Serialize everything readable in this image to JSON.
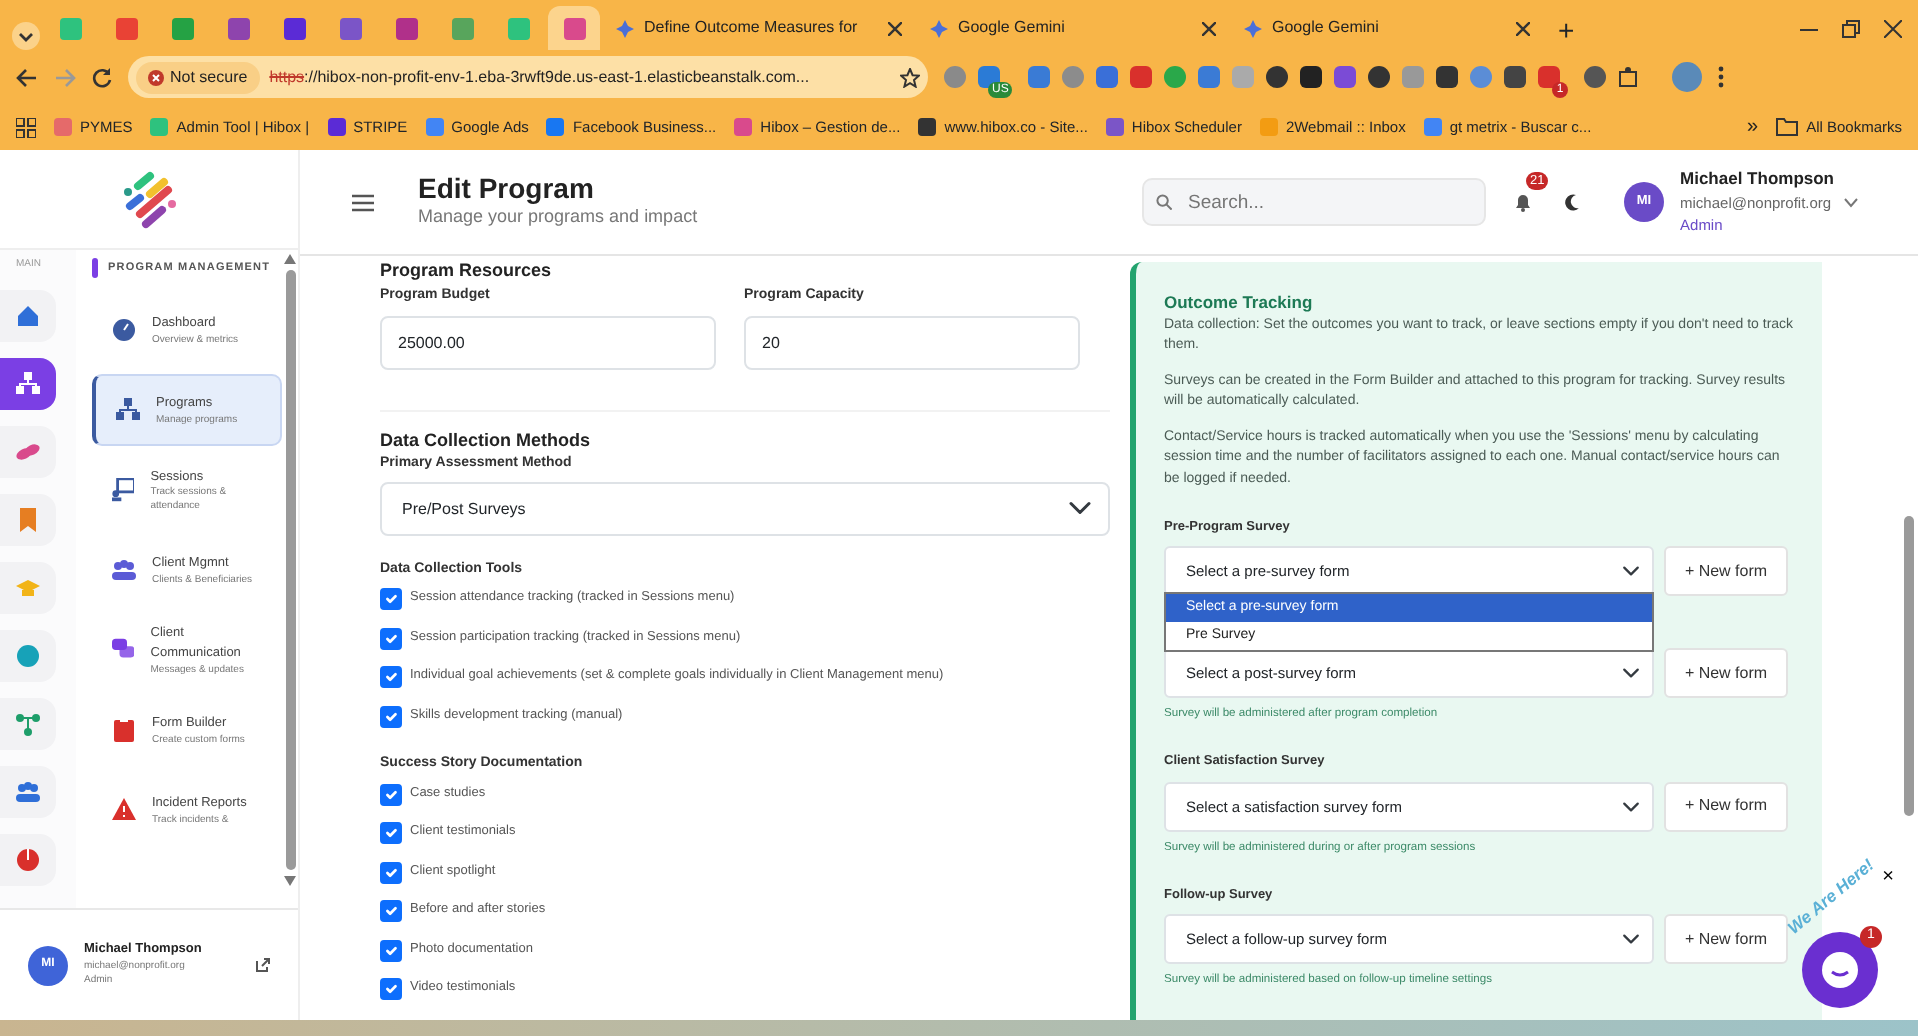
{
  "browser": {
    "tabs": [
      {
        "selected": false
      },
      {
        "selected": false
      },
      {
        "selected": false
      },
      {
        "selected": false
      },
      {
        "selected": false
      },
      {
        "selected": false
      },
      {
        "selected": false
      },
      {
        "selected": false
      },
      {
        "selected": false
      },
      {
        "selected": true
      },
      {
        "title": "Define Outcome Measures for",
        "selected": false
      },
      {
        "title": "Google Gemini",
        "selected": false
      },
      {
        "title": "Google Gemini",
        "selected": false
      }
    ],
    "new_tab": "+",
    "address": {
      "security": "Not secure",
      "scheme": "https",
      "rest": "://hibox-non-profit-env-1.eba-3rwft9de.us-east-1.elasticbeanstalk.com..."
    },
    "extension_badges": {
      "us": "US",
      "count": "1"
    },
    "bookmarks": [
      "PYMES",
      "Admin Tool | Hibox |",
      "STRIPE",
      "Google Ads",
      "Facebook Business...",
      "Hibox – Gestion de...",
      "www.hibox.co - Site...",
      "Hibox Scheduler",
      "2Webmail :: Inbox",
      "gt metrix - Buscar c..."
    ],
    "more_bookmarks": "»",
    "all_bookmarks": "All Bookmarks"
  },
  "header": {
    "title": "Edit Program",
    "subtitle": "Manage your programs and impact",
    "search": {
      "placeholder": "Search..."
    },
    "notifications": "21",
    "user": {
      "initials": "MI",
      "name": "Michael Thompson",
      "email": "michael@nonprofit.org",
      "role": "Admin"
    }
  },
  "sidebar": {
    "rail_label": "MAIN",
    "rail": [
      {
        "selected": false
      },
      {
        "selected": true
      },
      {
        "selected": false
      },
      {
        "selected": false
      },
      {
        "selected": false
      },
      {
        "selected": false
      },
      {
        "selected": false
      },
      {
        "selected": false
      },
      {
        "selected": false
      }
    ],
    "section": "PROGRAM MANAGEMENT",
    "items": [
      {
        "title": "Dashboard",
        "subtitle": "Overview & metrics",
        "selected": false
      },
      {
        "title": "Programs",
        "subtitle": "Manage programs",
        "selected": true
      },
      {
        "title": "Sessions",
        "subtitle": "Track sessions & attendance",
        "selected": false
      },
      {
        "title": "Client Mgmnt",
        "subtitle": "Clients & Beneficiaries",
        "selected": false
      },
      {
        "title": "Client Communication",
        "subtitle": "Messages & updates",
        "selected": false
      },
      {
        "title": "Form Builder",
        "subtitle": "Create custom forms",
        "selected": false
      },
      {
        "title": "Incident Reports",
        "subtitle": "Track incidents &",
        "selected": false
      }
    ],
    "user": {
      "initials": "MI",
      "name": "Michael Thompson",
      "email": "michael@nonprofit.org",
      "role": "Admin"
    }
  },
  "resources": {
    "title": "Program Resources",
    "fields": [
      {
        "label": "Program Budget",
        "value": "25000.00"
      },
      {
        "label": "Program Capacity",
        "value": "20"
      }
    ]
  },
  "methods": {
    "title": "Data Collection Methods",
    "select_label": "Primary Assessment Method",
    "select_value": "Pre/Post Surveys",
    "groups": [
      {
        "title": "Data Collection Tools",
        "options": [
          {
            "label": "Session attendance tracking (tracked in Sessions menu)",
            "checked": true
          },
          {
            "label": "Session participation tracking (tracked in Sessions menu)",
            "checked": true
          },
          {
            "label": "Individual goal achievements (set & complete goals individually in Client Management menu)",
            "checked": true
          },
          {
            "label": "Skills development tracking (manual)",
            "checked": true
          }
        ]
      },
      {
        "title": "Success Story Documentation",
        "options": [
          {
            "label": "Case studies",
            "checked": true
          },
          {
            "label": "Client testimonials",
            "checked": true
          },
          {
            "label": "Client spotlight",
            "checked": true
          },
          {
            "label": "Before and after stories",
            "checked": true
          },
          {
            "label": "Photo documentation",
            "checked": true
          },
          {
            "label": "Video testimonials",
            "checked": true
          }
        ]
      }
    ]
  },
  "outcome": {
    "title": "Outcome Tracking",
    "paragraphs": [
      {
        "text": "Data collection: Set the outcomes you want to track, or leave sections empty if you don't need to track them."
      },
      {
        "text": "Surveys can be created in the",
        "link": "Form Builder",
        "after": "and attached to this program for tracking. Survey results will be automatically calculated."
      },
      {
        "text": "Contact/Service hours is tracked automatically when you use the 'Sessions' menu by calculating session time and the number of facilitators assigned to each one. Manual contact/service hours can be logged if needed."
      }
    ],
    "surveys": [
      {
        "label": "Pre-Program Survey",
        "value": "Select a pre-survey form",
        "button": "+ New form",
        "open_options": [
          {
            "label": "Select a pre-survey form",
            "selected": true
          },
          {
            "label": "Pre Survey",
            "selected": false
          }
        ]
      },
      {
        "value": "Select a post-survey form",
        "button": "+ New form",
        "help": "Survey will be administered after program completion"
      },
      {
        "label": "Client Satisfaction Survey",
        "value": "Select a satisfaction survey form",
        "button": "+ New form",
        "help": "Survey will be administered during or after program sessions"
      },
      {
        "label": "Follow-up Survey",
        "value": "Select a follow-up survey form",
        "button": "+ New form",
        "help": "Survey will be administered based on follow-up timeline settings"
      }
    ]
  },
  "chat_widget": {
    "caption": "We Are Here!",
    "badge": "1",
    "close": "×"
  }
}
